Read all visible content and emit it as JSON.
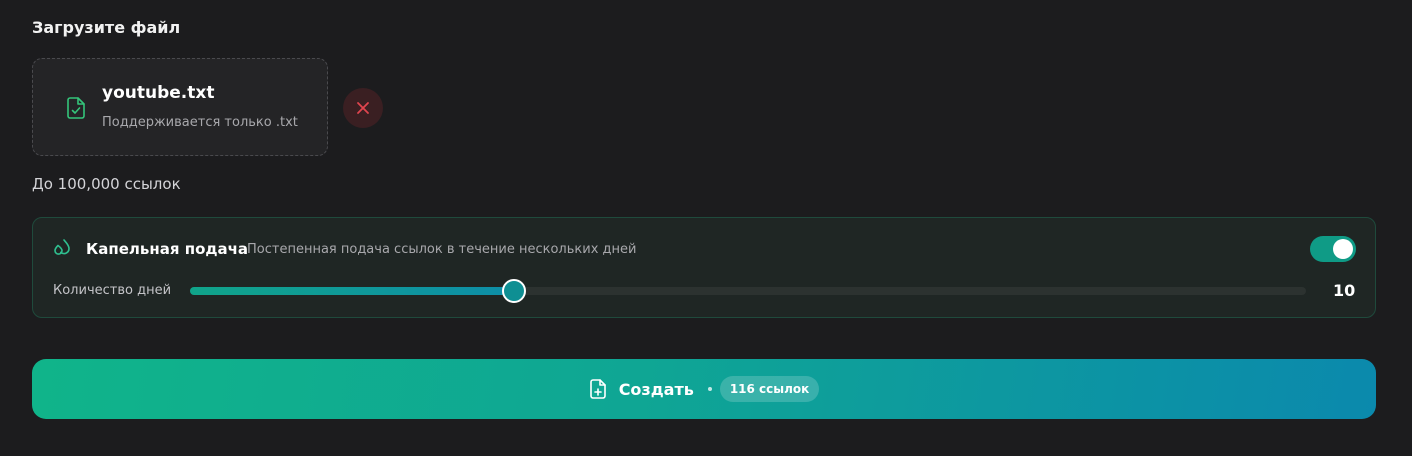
{
  "upload": {
    "title": "Загрузите файл",
    "file_name": "youtube.txt",
    "hint": "Поддерживается только .txt",
    "file_icon": "file-check-icon",
    "remove_icon": "close-icon"
  },
  "limit_text": "До 100,000 ссылок",
  "drip": {
    "icon": "droplets-icon",
    "title": "Капельная подача",
    "description": "Постепенная подача ссылок в течение нескольких дней",
    "enabled": true,
    "days_label": "Количество дней",
    "days_value": "10",
    "slider_fraction": 0.29
  },
  "create": {
    "icon": "file-plus-icon",
    "label": "Создать",
    "count_badge": "116 ссылок"
  },
  "colors": {
    "accent": "#10a48a",
    "accent_end": "#0b89ad",
    "danger": "#e0454f",
    "background": "#1c1c1e"
  }
}
